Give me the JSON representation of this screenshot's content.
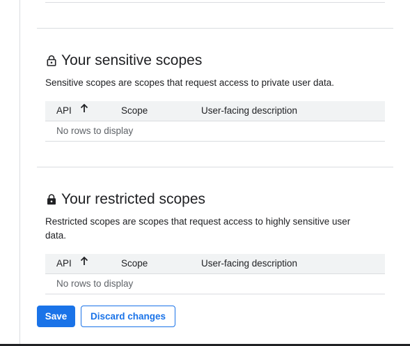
{
  "sensitive": {
    "title": "Your sensitive scopes",
    "icon": "lock-outline-icon",
    "description": "Sensitive scopes are scopes that request access to private user data.",
    "columns": [
      "API",
      "Scope",
      "User-facing description"
    ],
    "sort_icon": "arrow-upward-icon",
    "empty_text": "No rows to display"
  },
  "restricted": {
    "title": "Your restricted scopes",
    "icon": "lock-filled-icon",
    "description": "Restricted scopes are scopes that request access to highly sensitive user data.",
    "columns": [
      "API",
      "Scope",
      "User-facing description"
    ],
    "sort_icon": "arrow-upward-icon",
    "empty_text": "No rows to display"
  },
  "actions": {
    "save_label": "Save",
    "discard_label": "Discard changes"
  },
  "colors": {
    "accent": "#1a73e8",
    "header_bg": "#f1f3f4",
    "divider": "#dadce0",
    "muted_text": "#5f6368"
  }
}
